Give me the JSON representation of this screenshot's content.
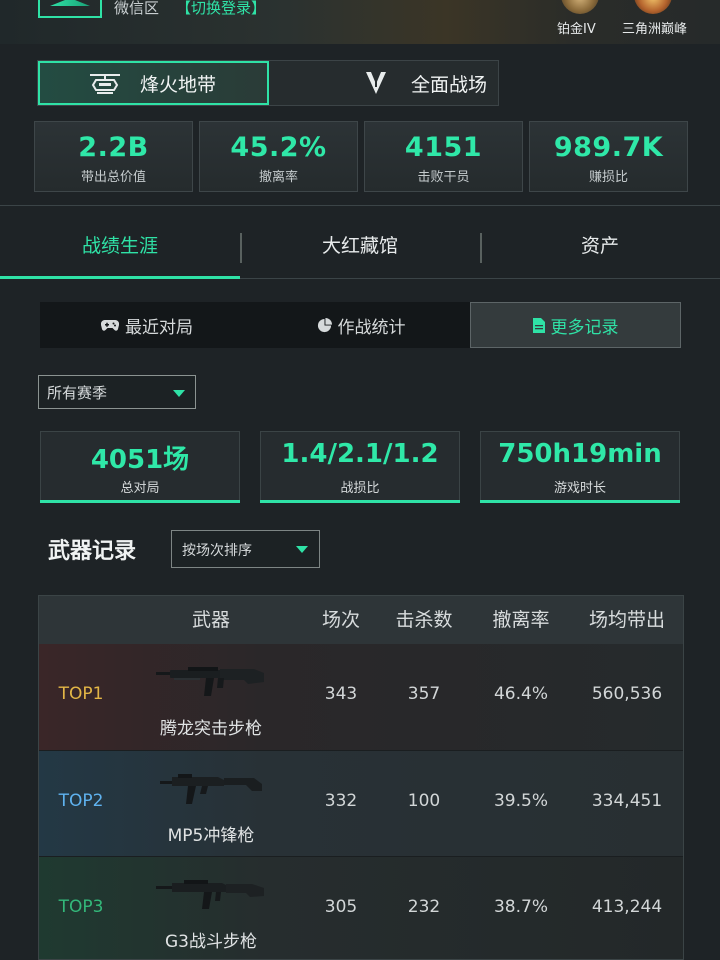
{
  "header": {
    "region": "微信区",
    "switch_login": "【切换登录】",
    "ranks": [
      {
        "label": "铂金IV",
        "icon": "platinum-rank-badge"
      },
      {
        "label": "三角洲巅峰",
        "icon": "delta-peak-rank-badge"
      }
    ]
  },
  "modes": [
    {
      "label": "烽火地带",
      "icon": "helicopter-icon",
      "active": true
    },
    {
      "label": "全面战场",
      "icon": "arrow-emblem-icon",
      "active": false
    }
  ],
  "overview_stats": [
    {
      "value": "2.2B",
      "label": "带出总价值"
    },
    {
      "value": "45.2%",
      "label": "撤离率"
    },
    {
      "value": "4151",
      "label": "击败干员"
    },
    {
      "value": "989.7K",
      "label": "赚损比"
    }
  ],
  "main_tabs": [
    {
      "label": "战绩生涯",
      "active": true
    },
    {
      "label": "大红藏馆",
      "active": false
    },
    {
      "label": "资产",
      "active": false
    }
  ],
  "sub_tabs": [
    {
      "label": "最近对局",
      "icon": "gamepad-icon",
      "active": false
    },
    {
      "label": "作战统计",
      "icon": "pie-chart-icon",
      "active": false
    },
    {
      "label": "更多记录",
      "icon": "document-icon",
      "active": true
    }
  ],
  "season_filter": {
    "selected": "所有赛季"
  },
  "summary_stats": [
    {
      "value": "4051场",
      "label": "总对局"
    },
    {
      "value": "1.4/2.1/1.2",
      "label": "战损比"
    },
    {
      "value": "750h19min",
      "label": "游戏时长"
    }
  ],
  "weapon_records": {
    "title": "武器记录",
    "sort_selected": "按场次排序",
    "columns": [
      "武器",
      "场次",
      "击杀数",
      "撤离率",
      "场均带出"
    ],
    "rows": [
      {
        "rank": "TOP1",
        "weapon": "腾龙突击步枪",
        "matches": "343",
        "kills": "357",
        "extract_rate": "46.4%",
        "avg_loot": "560,536"
      },
      {
        "rank": "TOP2",
        "weapon": "MP5冲锋枪",
        "matches": "332",
        "kills": "100",
        "extract_rate": "39.5%",
        "avg_loot": "334,451"
      },
      {
        "rank": "TOP3",
        "weapon": "G3战斗步枪",
        "matches": "305",
        "kills": "232",
        "extract_rate": "38.7%",
        "avg_loot": "413,244"
      }
    ]
  },
  "colors": {
    "accent": "#2fe2a6",
    "top1": "#e3b646",
    "top2": "#5fb2ef",
    "top3": "#33b87a"
  }
}
